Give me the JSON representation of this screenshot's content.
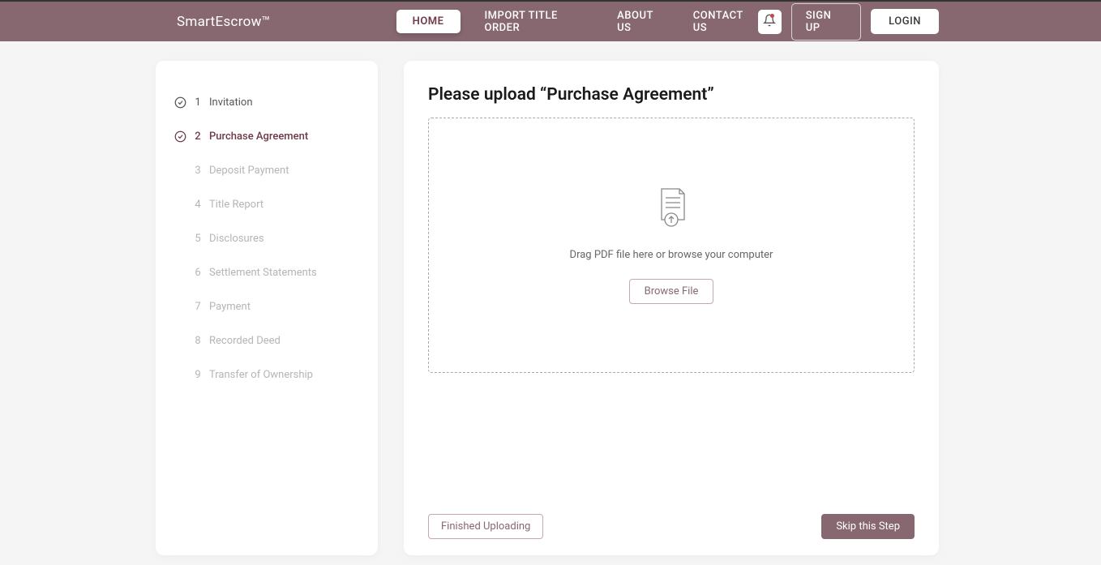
{
  "brand": "SmartEscrow™",
  "nav": {
    "home": "HOME",
    "import": "IMPORT TITLE ORDER",
    "about": "ABOUT US",
    "contact": "CONTACT US"
  },
  "auth": {
    "signup": "SIGN UP",
    "login": "LOGIN"
  },
  "steps": [
    {
      "num": "1",
      "label": "Invitation",
      "status": "completed"
    },
    {
      "num": "2",
      "label": "Purchase Agreement",
      "status": "active"
    },
    {
      "num": "3",
      "label": "Deposit Payment",
      "status": "inactive"
    },
    {
      "num": "4",
      "label": "Title Report",
      "status": "inactive"
    },
    {
      "num": "5",
      "label": "Disclosures",
      "status": "inactive"
    },
    {
      "num": "6",
      "label": "Settlement Statements",
      "status": "inactive"
    },
    {
      "num": "7",
      "label": "Payment",
      "status": "inactive"
    },
    {
      "num": "8",
      "label": "Recorded Deed",
      "status": "inactive"
    },
    {
      "num": "9",
      "label": "Transfer of Ownership",
      "status": "inactive"
    }
  ],
  "main": {
    "title": "Please upload “Purchase Agreement”",
    "drop_text": "Drag PDF file here or browse your computer",
    "browse_btn": "Browse File",
    "finish_btn": "Finished Uploading",
    "skip_btn": "Skip this Step"
  }
}
